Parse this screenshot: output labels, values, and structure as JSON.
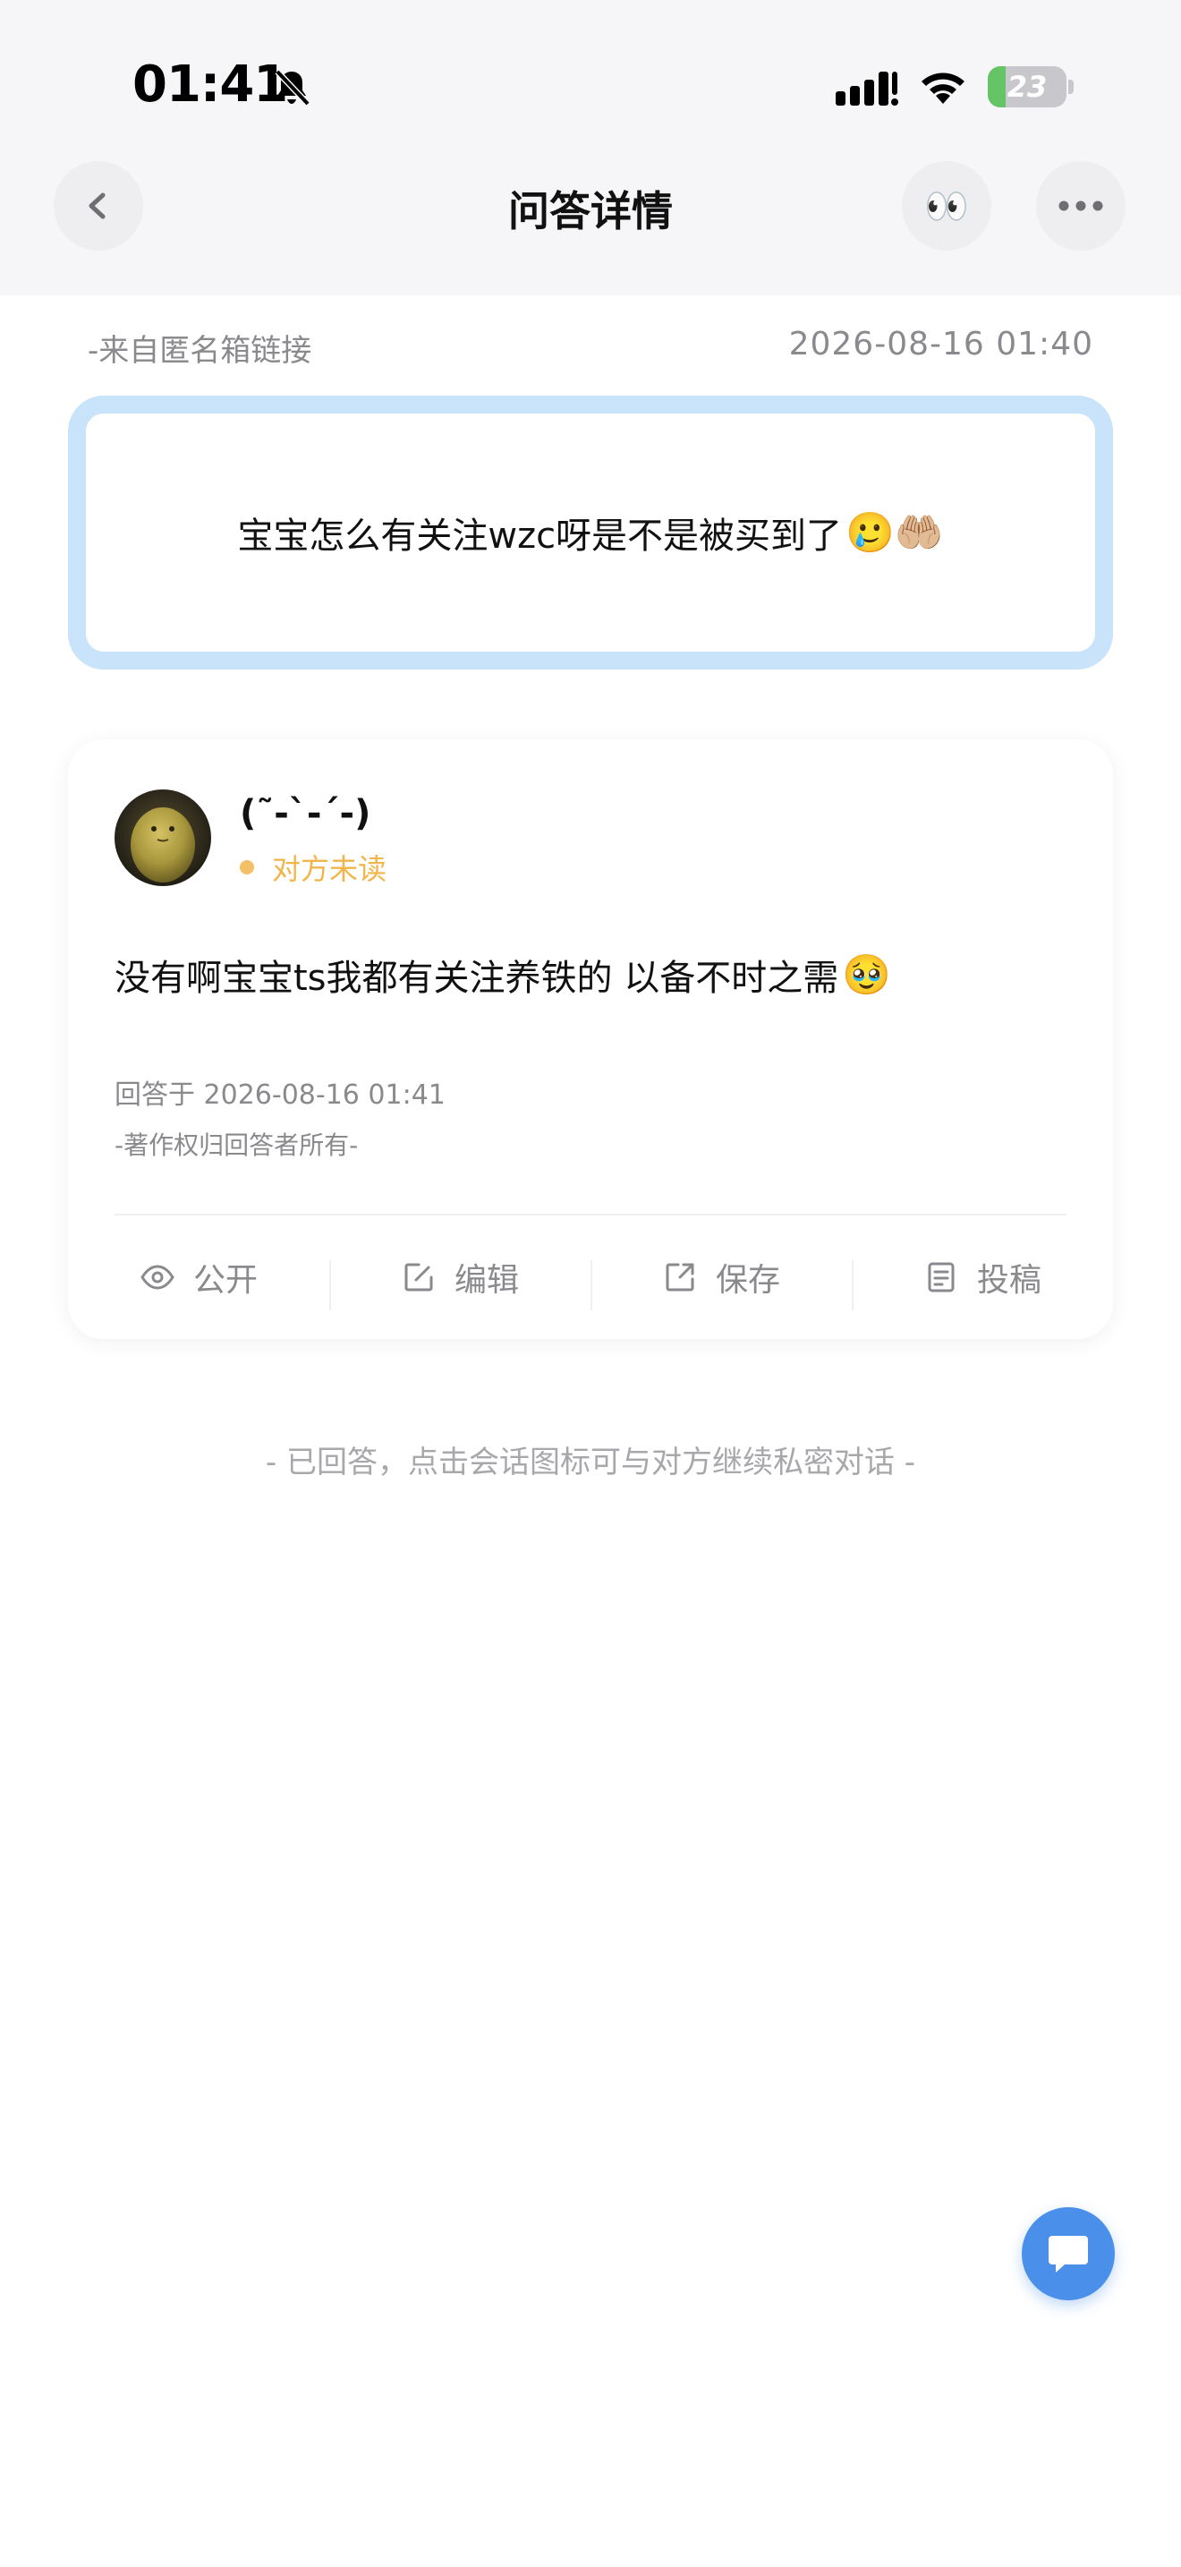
{
  "status_bar": {
    "time": "01:41",
    "battery": "23",
    "battery_level": 0.23,
    "icons": [
      "bell-muted-icon",
      "signal-icon",
      "wifi-icon",
      "battery-charging-icon"
    ]
  },
  "nav": {
    "title": "问答详情",
    "back_icon": "chevron-left-icon",
    "eyes_emoji": "👀",
    "more_icon": "ellipsis-icon"
  },
  "question": {
    "source": "-来自匿名箱链接",
    "time": "2026-08-16 01:40",
    "text": "宝宝怎么有关注wzc呀是不是被买到了",
    "emojis": "🥲🤲🏼"
  },
  "answer": {
    "user_name": "(˜-`-´-)",
    "read_status": "对方未读",
    "text": "没有啊宝宝ts我都有关注养铁的 以备不时之需",
    "emoji": "🥹",
    "time": "回答于 2026-08-16 01:41",
    "copyright": "-著作权归回答者所有-"
  },
  "actions": [
    {
      "label": "公开",
      "icon": "eye-icon"
    },
    {
      "label": "编辑",
      "icon": "edit-icon"
    },
    {
      "label": "保存",
      "icon": "share-icon"
    },
    {
      "label": "投稿",
      "icon": "document-icon"
    }
  ],
  "hint": "- 已回答，点击会话图标可与对方继续私密对话 -",
  "chat_fab_icon": "chat-bubble-icon",
  "colors": {
    "accent": "#4a8fe9",
    "question_border": "#c9e3fb",
    "unread": "#f1b54a",
    "battery_green": "#65c466"
  }
}
